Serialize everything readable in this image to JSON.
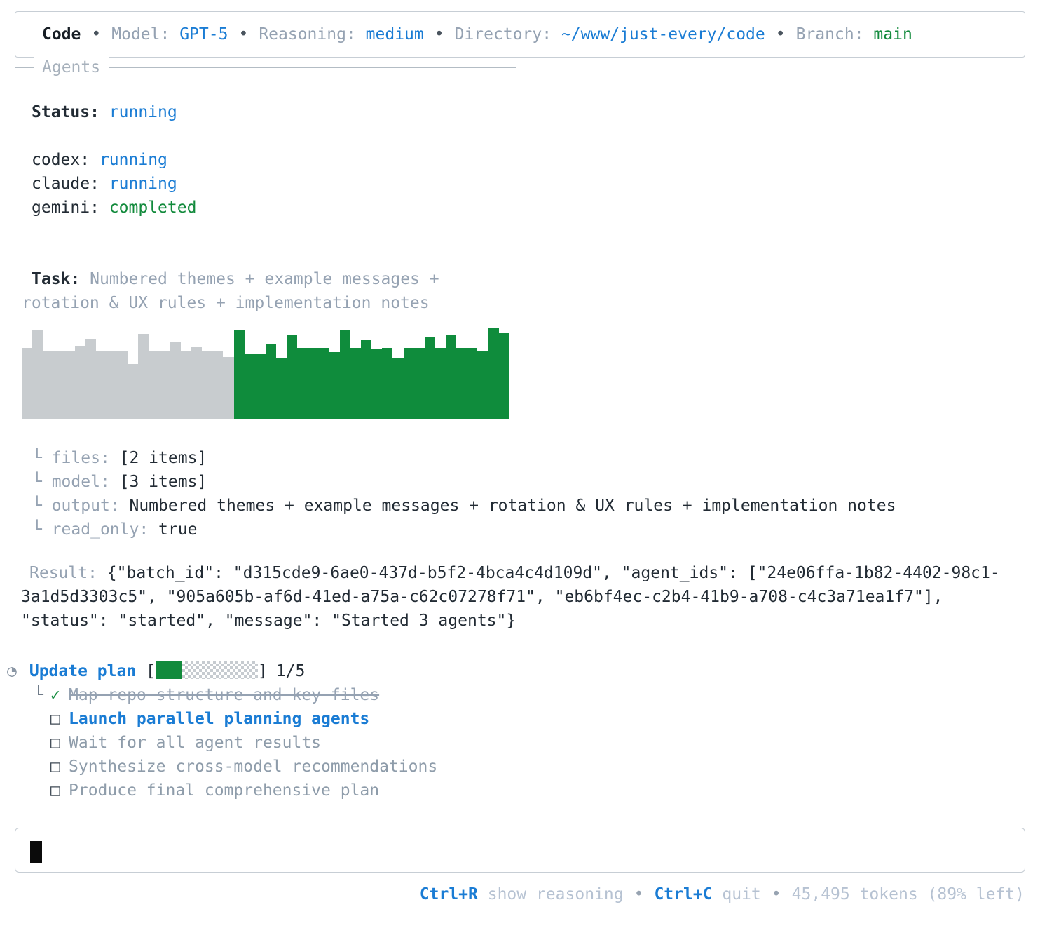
{
  "header": {
    "app": "Code",
    "model_label": "Model:",
    "model": "GPT-5",
    "reasoning_label": "Reasoning:",
    "reasoning": "medium",
    "directory_label": "Directory:",
    "directory": "~/www/just-every/code",
    "branch_label": "Branch:",
    "branch": "main"
  },
  "agents_panel": {
    "title": "Agents",
    "status_label": "Status:",
    "status": "running",
    "agents": [
      {
        "name": "codex:",
        "state": "running"
      },
      {
        "name": "claude:",
        "state": "running"
      },
      {
        "name": "gemini:",
        "state": "completed"
      }
    ],
    "task_label": "Task:",
    "task": " Numbered themes + example messages + rotation & UX rules + implementation notes"
  },
  "chart_data": {
    "type": "bar",
    "title": "agent activity sparkline",
    "heights": [
      0.78,
      0.97,
      0.74,
      0.74,
      0.74,
      0.8,
      0.88,
      0.74,
      0.74,
      0.74,
      0.6,
      0.93,
      0.74,
      0.74,
      0.84,
      0.74,
      0.79,
      0.74,
      0.74,
      0.68,
      0.98,
      0.71,
      0.71,
      0.82,
      0.66,
      0.92,
      0.78,
      0.78,
      0.78,
      0.73,
      0.97,
      0.78,
      0.86,
      0.76,
      0.78,
      0.66,
      0.78,
      0.78,
      0.9,
      0.78,
      0.92,
      0.78,
      0.78,
      0.74,
      1.0,
      0.94
    ],
    "gray_count": 20,
    "colors": {
      "inactive": "#c8cccf",
      "active": "#0f8c3c"
    }
  },
  "details": [
    {
      "tree": "└ ",
      "key": "files: ",
      "value": "[2 items]"
    },
    {
      "tree": "└ ",
      "key": "model: ",
      "value": "[3 items]"
    },
    {
      "tree": "└ ",
      "key": "output: ",
      "value": "Numbered themes + example messages + rotation & UX rules + implementation notes"
    },
    {
      "tree": "└ ",
      "key": "read_only: ",
      "value": "true"
    }
  ],
  "result": {
    "label": "Result: ",
    "text": "{\"batch_id\": \"d315cde9-6ae0-437d-b5f2-4bca4c4d109d\", \"agent_ids\": [\"24e06ffa-1b82-4402-98c1-3a1d5d3303c5\", \"905a605b-af6d-41ed-a75a-c62c07278f71\", \"eb6bf4ec-c2b4-41b9-a708-c4c3a71ea1f7\"], \"status\": \"started\", \"message\": \"Started 3 agents\"}"
  },
  "plan": {
    "spinner": "◔",
    "title": "Update plan",
    "bracket_open": "[",
    "bracket_close": "]",
    "progress_text": "1/5",
    "items": [
      {
        "tree": "└",
        "marker": "✓",
        "label": "Map repo structure and key files",
        "state": "done"
      },
      {
        "tree": "",
        "marker": "□",
        "label": "Launch parallel planning agents",
        "state": "current"
      },
      {
        "tree": "",
        "marker": "□",
        "label": "Wait for all agent results",
        "state": "pending"
      },
      {
        "tree": "",
        "marker": "□",
        "label": "Synthesize cross-model recommendations",
        "state": "pending"
      },
      {
        "tree": "",
        "marker": "□",
        "label": "Produce final comprehensive plan",
        "state": "pending"
      }
    ]
  },
  "footer": {
    "shortcut1_key": "Ctrl+R",
    "shortcut1_label": " show reasoning",
    "shortcut2_key": "Ctrl+C",
    "shortcut2_label": " quit",
    "tokens": "45,495 tokens (89% left)"
  }
}
